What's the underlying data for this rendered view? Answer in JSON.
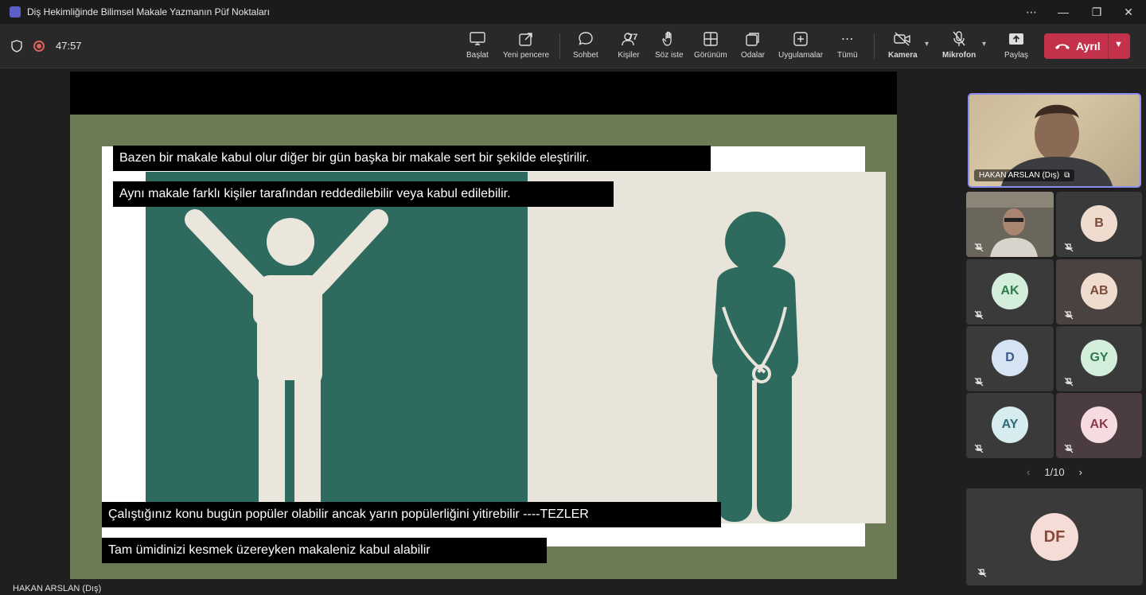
{
  "window": {
    "title": "Diş Hekimliğinde Bilimsel Makale Yazmanın Püf Noktaları"
  },
  "meeting": {
    "timer": "47:57",
    "toolbar": {
      "start": "Başlat",
      "new_window": "Yeni pencere",
      "chat": "Sohbet",
      "people": "Kişiler",
      "people_count": "77",
      "raise_hand": "Söz iste",
      "view": "Görünüm",
      "rooms": "Odalar",
      "apps": "Uygulamalar",
      "more": "Tümü",
      "camera": "Kamera",
      "mic": "Mikrofon",
      "share": "Paylaş",
      "leave": "Ayrıl"
    }
  },
  "slide": {
    "captions": [
      "Bazen bir makale kabul olur diğer bir gün başka bir makale sert bir şekilde eleştirilir.",
      "Aynı makale farklı kişiler tarafından reddedilebilir veya kabul edilebilir.",
      "Çalıştığınız konu bugün popüler olabilir ancak yarın popülerliğini yitirebilir ----TEZLER",
      "Tam ümidinizi kesmek üzereyken makaleniz kabul alabilir"
    ],
    "colors": {
      "background": "#6c7a55",
      "teal": "#2e6b5e",
      "cream": "#e9e4da"
    }
  },
  "presenter": {
    "name": "HAKAN ARSLAN (Dış)"
  },
  "participants": {
    "main": {
      "name": "HAKAN ARSLAN (Dış)"
    },
    "tiles": [
      {
        "initials": "",
        "video": true
      },
      {
        "initials": "B",
        "color": "#f0dccf"
      },
      {
        "initials": "AK",
        "color": "#d4eedc"
      },
      {
        "initials": "AB",
        "color": "#f0dccf"
      },
      {
        "initials": "D",
        "color": "#d6e3f3"
      },
      {
        "initials": "GY",
        "color": "#d4eedc"
      },
      {
        "initials": "AY",
        "color": "#d6ecef"
      },
      {
        "initials": "AK",
        "color": "#f6dbe1"
      }
    ],
    "pager": "1/10",
    "large": {
      "initials": "DF",
      "color": "#f6dcd7"
    }
  }
}
